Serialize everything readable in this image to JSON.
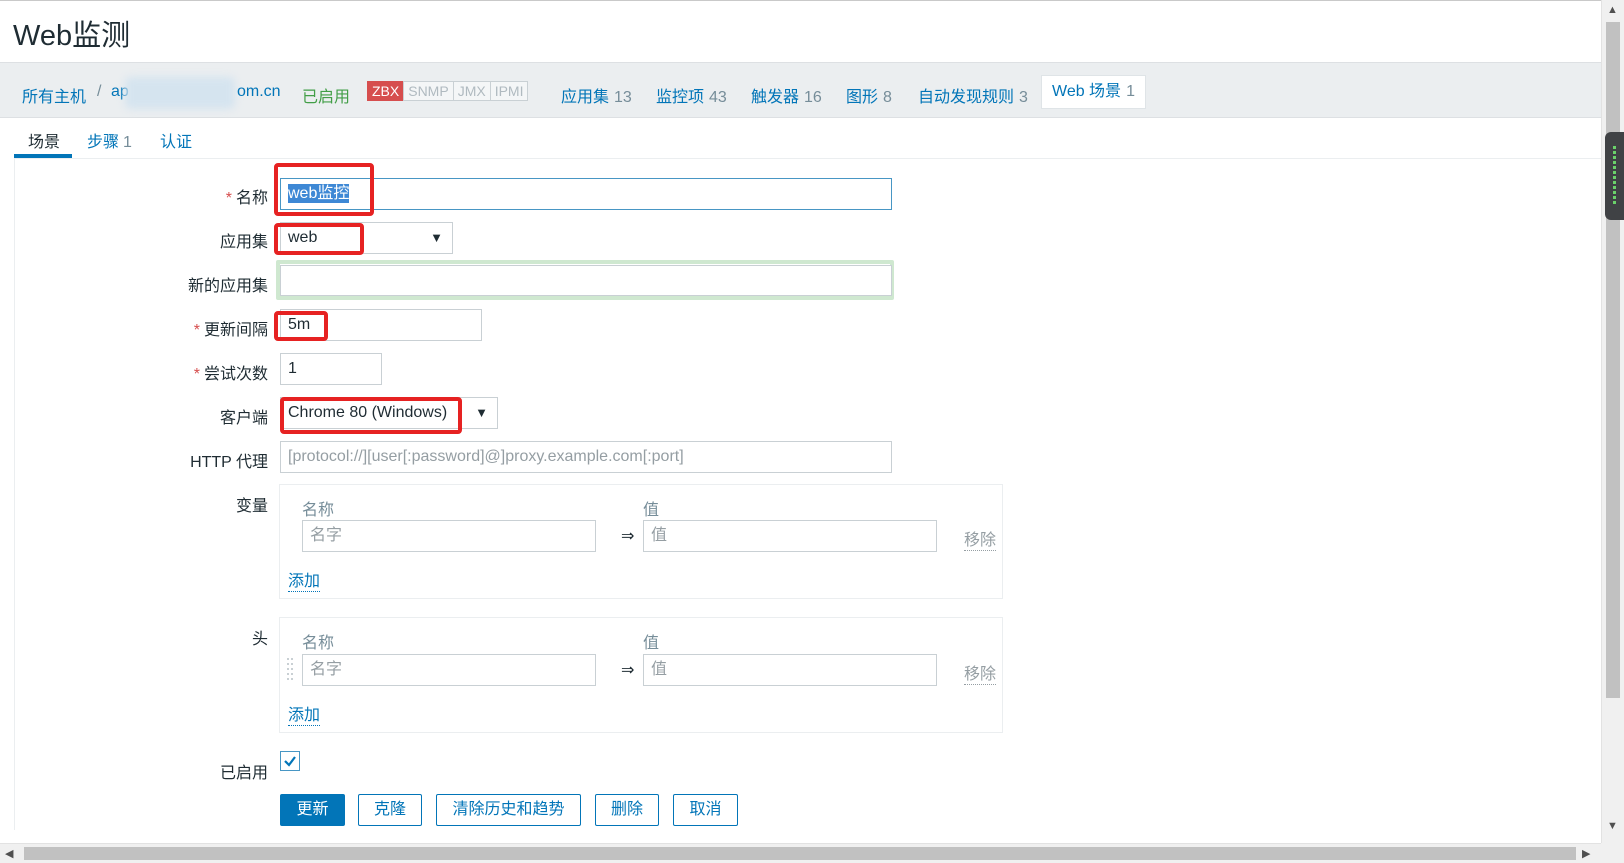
{
  "page": {
    "title": "Web监测"
  },
  "hostbar": {
    "all_hosts": "所有主机",
    "separator": "/",
    "host_prefix": "ap",
    "host_suffix": "om.cn",
    "enabled": "已启用",
    "badges": [
      "ZBX",
      "SNMP",
      "JMX",
      "IPMI"
    ],
    "apps": {
      "label": "应用集",
      "count": "13"
    },
    "items": {
      "label": "监控项",
      "count": "43"
    },
    "triggers": {
      "label": "触发器",
      "count": "16"
    },
    "graphs": {
      "label": "图形",
      "count": "8"
    },
    "discovery": {
      "label": "自动发现规则",
      "count": "3"
    },
    "web": {
      "label": "Web 场景",
      "count": "1"
    }
  },
  "tabs": {
    "scenario": "场景",
    "steps": {
      "label": "步骤",
      "count": "1"
    },
    "auth": "认证"
  },
  "form": {
    "name": {
      "label": "名称",
      "value": "web监控"
    },
    "application": {
      "label": "应用集",
      "value": "web",
      "arrow": "▼"
    },
    "new_application": {
      "label": "新的应用集",
      "value": ""
    },
    "update_interval": {
      "label": "更新间隔",
      "value": "5m"
    },
    "attempts": {
      "label": "尝试次数",
      "value": "1"
    },
    "agent": {
      "label": "客户端",
      "value": "Chrome 80 (Windows)",
      "arrow": "▼"
    },
    "http_proxy": {
      "label": "HTTP 代理",
      "placeholder": "[protocol://][user[:password]@]proxy.example.com[:port]"
    },
    "variables": {
      "label": "变量",
      "col_name": "名称",
      "col_value": "值",
      "name_placeholder": "名字",
      "value_placeholder": "值",
      "arrow": "⇒",
      "remove": "移除",
      "add": "添加"
    },
    "headers": {
      "label": "头",
      "col_name": "名称",
      "col_value": "值",
      "name_placeholder": "名字",
      "value_placeholder": "值",
      "arrow": "⇒",
      "remove": "移除",
      "add": "添加"
    },
    "enabled": {
      "label": "已启用",
      "checked": true
    }
  },
  "buttons": {
    "update": "更新",
    "clone": "克隆",
    "clear_history": "清除历史和趋势",
    "delete": "删除",
    "cancel": "取消"
  },
  "colors": {
    "link": "#0275b8",
    "enabled_green": "#429e47",
    "zbx_red": "#d64e4e",
    "highlight_box": "#e62222"
  },
  "scroll": {
    "up": "▲",
    "down": "▼",
    "left": "◀",
    "right": "▶"
  }
}
